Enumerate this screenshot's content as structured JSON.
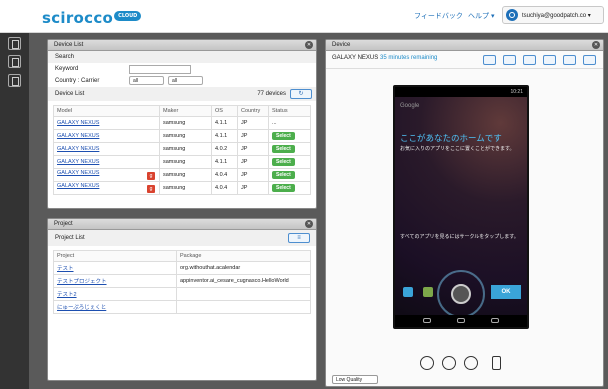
{
  "header": {
    "logo_text": "scirocco",
    "logo_badge": "CLOUD",
    "feedback": "フィードバック",
    "help": "ヘルプ ▾",
    "user_email": "tsuchiya@goodpatch.co ▾"
  },
  "sidebar": {
    "icons": [
      "device-icon",
      "checklist-icon",
      "search-doc-icon"
    ]
  },
  "device_list": {
    "panel_title": "Device List",
    "search_label": "Search",
    "keyword_label": "Keyword",
    "keyword_value": "",
    "country_label": "Country : Carrier",
    "country_select": "all",
    "carrier_select": "all",
    "list_label": "Device List",
    "count": "77 devices",
    "columns": [
      "Model",
      "Maker",
      "OS",
      "Country",
      "Status"
    ],
    "rows": [
      {
        "model": "GALAXY NEXUS",
        "maker": "samsung",
        "os": "4.1.1",
        "country": "JP",
        "status": "...",
        "g": false
      },
      {
        "model": "GALAXY NEXUS",
        "maker": "samsung",
        "os": "4.1.1",
        "country": "JP",
        "status": "Select",
        "g": false
      },
      {
        "model": "GALAXY NEXUS",
        "maker": "samsung",
        "os": "4.0.2",
        "country": "JP",
        "status": "Select",
        "g": false
      },
      {
        "model": "GALAXY NEXUS",
        "maker": "samsung",
        "os": "4.1.1",
        "country": "JP",
        "status": "Select",
        "g": false
      },
      {
        "model": "GALAXY NEXUS",
        "maker": "samsung",
        "os": "4.0.4",
        "country": "JP",
        "status": "Select",
        "g": true
      },
      {
        "model": "GALAXY NEXUS",
        "maker": "samsung",
        "os": "4.0.4",
        "country": "JP",
        "status": "Select",
        "g": true
      }
    ]
  },
  "project": {
    "panel_title": "Project",
    "list_label": "Project List",
    "columns": [
      "Project",
      "Package"
    ],
    "rows": [
      {
        "name": "テスト",
        "pkg": "org.withouthat.acalendar"
      },
      {
        "name": "テストプロジェクト",
        "pkg": "appinventor.ai_cesare_cugnasco.HelloWorld"
      },
      {
        "name": "テスト2",
        "pkg": ""
      },
      {
        "name": "にゅーぷろじぇくと",
        "pkg": ""
      }
    ]
  },
  "device": {
    "panel_title": "Device",
    "device_name": "GALAXY NEXUS",
    "remaining": "35 minutes remaining",
    "quality": "Low Quality",
    "screen": {
      "time": "10:21",
      "home_title": "ここがあなたのホームです",
      "home_sub": "お気に入りのアプリをここに置くことができます。",
      "all_apps_sub": "すべてのアプリを見るにはサークルをタップします。",
      "ok": "OK",
      "google": "Google"
    }
  }
}
